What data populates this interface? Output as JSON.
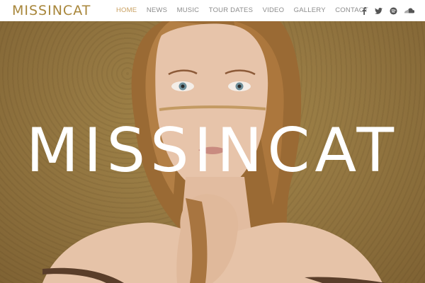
{
  "brand": {
    "logo_text": "MISSINCAT",
    "accent_color": "#a8863a"
  },
  "nav": {
    "items": [
      {
        "label": "HOME",
        "active": true
      },
      {
        "label": "NEWS",
        "active": false
      },
      {
        "label": "MUSIC",
        "active": false
      },
      {
        "label": "TOUR DATES",
        "active": false
      },
      {
        "label": "VIDEO",
        "active": false
      },
      {
        "label": "GALLERY",
        "active": false
      },
      {
        "label": "CONTACT",
        "active": false
      }
    ],
    "active_color": "#c9a061",
    "inactive_color": "#8c8c8c"
  },
  "social": {
    "icons": [
      "facebook-icon",
      "twitter-icon",
      "spotify-icon",
      "soundcloud-icon"
    ]
  },
  "hero": {
    "title": "MISSINCAT"
  }
}
